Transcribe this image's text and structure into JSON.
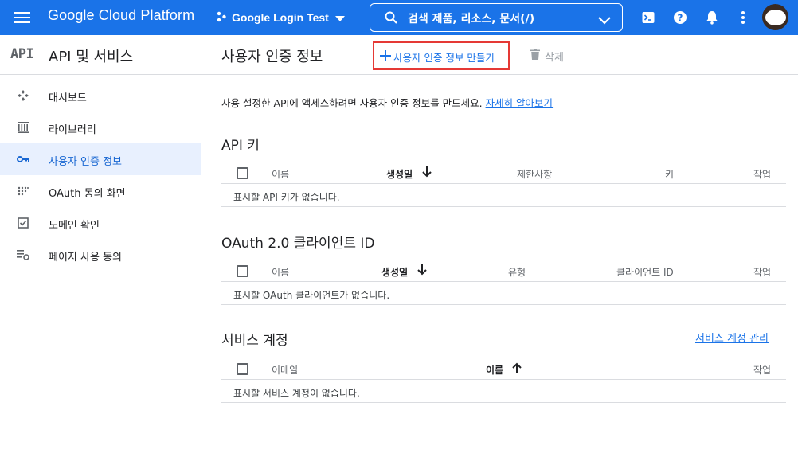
{
  "topbar": {
    "brand": "Google Cloud Platform",
    "project": "Google Login Test",
    "search_text": "검색   제품, 리소스, 문서(/)"
  },
  "sidebar": {
    "logo": "API",
    "title": "API 및 서비스",
    "items": [
      {
        "label": "대시보드",
        "icon": "dashboard-icon"
      },
      {
        "label": "라이브러리",
        "icon": "library-icon"
      },
      {
        "label": "사용자 인증 정보",
        "icon": "key-icon",
        "active": true
      },
      {
        "label": "OAuth 동의 화면",
        "icon": "oauth-consent-icon"
      },
      {
        "label": "도메인 확인",
        "icon": "checkbox-icon"
      },
      {
        "label": "페이지 사용 동의",
        "icon": "settings-list-icon"
      }
    ]
  },
  "main": {
    "title": "사용자 인증 정보",
    "create_label": "사용자 인증 정보 만들기",
    "delete_label": "삭제",
    "intro_text": "사용 설정한 API에 액세스하려면 사용자 인증 정보를 만드세요.",
    "intro_link": "자세히 알아보기"
  },
  "api_keys": {
    "title": "API 키",
    "columns": [
      "이름",
      "생성일",
      "제한사항",
      "키",
      "작업"
    ],
    "empty": "표시할 API 키가 없습니다."
  },
  "oauth": {
    "title": "OAuth 2.0 클라이언트 ID",
    "columns": [
      "이름",
      "생성일",
      "유형",
      "클라이언트 ID",
      "작업"
    ],
    "empty": "표시할 OAuth 클라이언트가 없습니다."
  },
  "service_accounts": {
    "title": "서비스 계정",
    "manage_link": "서비스 계정 관리",
    "columns": [
      "이메일",
      "이름",
      "작업"
    ],
    "empty": "표시할 서비스 계정이 없습니다."
  },
  "colors": {
    "primary": "#1a73e8",
    "highlight_border": "#e53935",
    "active_bg": "#e8f0fe"
  }
}
